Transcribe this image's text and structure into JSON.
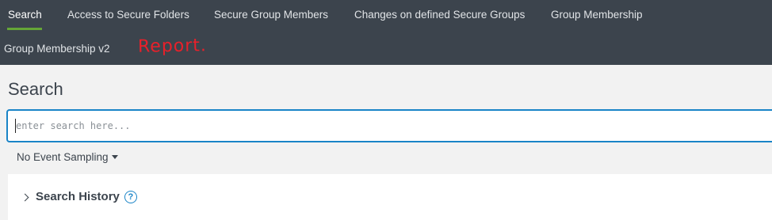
{
  "nav": {
    "items": [
      {
        "label": "Search",
        "active": true
      },
      {
        "label": "Access to Secure Folders",
        "active": false
      },
      {
        "label": "Secure Group Members",
        "active": false
      },
      {
        "label": "Changes on defined Secure Groups",
        "active": false
      },
      {
        "label": "Group Membership",
        "active": false
      },
      {
        "label": "Group Membership v2",
        "active": false
      }
    ],
    "annotation": "Report."
  },
  "main": {
    "title": "Search",
    "search": {
      "value": "",
      "placeholder": "enter search here..."
    },
    "sampling": {
      "label": "No Event Sampling",
      "icon": "caret-down-icon"
    },
    "history": {
      "label": "Search History",
      "help_icon": "?"
    }
  },
  "colors": {
    "nav_bg": "#3c444d",
    "active_underline": "#65a637",
    "focus_border": "#1a84c7",
    "annotation": "#e8202a",
    "page_bg": "#f2f2f2"
  }
}
